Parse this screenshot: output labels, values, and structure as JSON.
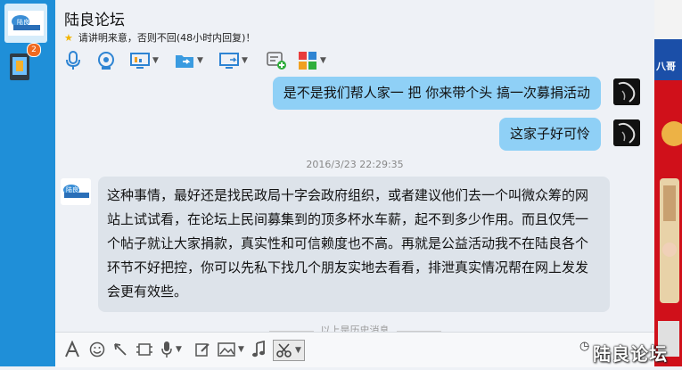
{
  "sidebar": {
    "badge_count": "2"
  },
  "header": {
    "title": "陆良论坛",
    "notice": "请讲明来意，否则不回(48小时内回复)！"
  },
  "toolbar": {
    "icons": [
      "microphone-icon",
      "webcam-icon",
      "screen-share-icon",
      "file-transfer-icon",
      "remote-desktop-icon",
      "add-app-icon",
      "apps-grid-icon"
    ]
  },
  "messages": {
    "out": [
      "是不是我们帮人家一 把  你来带个头  搞一次募捐活动",
      "这家子好可怜"
    ],
    "timestamp": "2016/3/23 22:29:35",
    "in": "这种事情，最好还是找民政局十字会政府组织，或者建议他们去一个叫微众筹的网站上试试看，在论坛上民间募集到的顶多杯水车薪，起不到多少作用。而且仅凭一个帖子就让大家捐款，真实性和可信赖度也不高。再就是公益活动我不在陆良各个环节不好把控，你可以先私下找几个朋友实地去看看，排泄真实情况帮在网上发发会更有效些。",
    "history_hint": "以上是历史消息"
  },
  "input_toolbar": {
    "icons": [
      "font-icon",
      "emoji-icon",
      "nudge-icon",
      "screenshot-icon",
      "voice-icon",
      "edit-icon",
      "image-icon",
      "music-icon",
      "scissors-icon"
    ]
  },
  "watermark": "陆良论坛",
  "right_ad": {
    "label": "八哥"
  },
  "colors": {
    "left_strip": "#1f8fd8",
    "out_bubble": "#8fd0f6",
    "in_bubble": "#dde3ea",
    "background": "#eef1f6",
    "accent_red": "#d0101a"
  }
}
